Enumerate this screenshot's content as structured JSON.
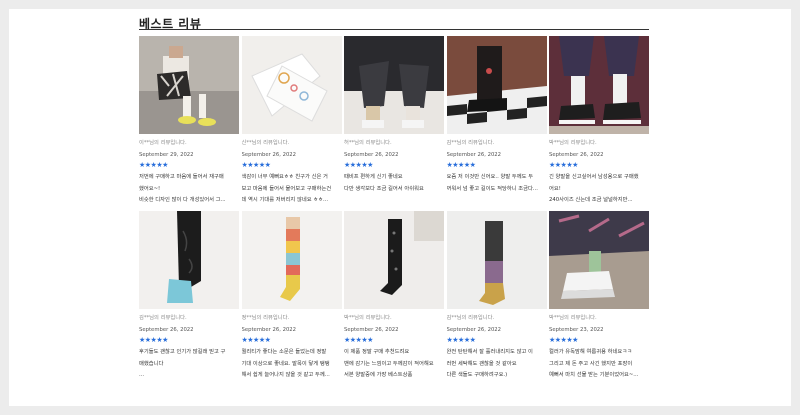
{
  "section": {
    "title": "베스트 리뷰"
  },
  "colors": {
    "star": "#2a6fdb",
    "rule": "#333333"
  },
  "reviews": [
    {
      "reviewer": "이**님의 리뷰입니다.",
      "date": "September 29, 2022",
      "stars": "★★★★★",
      "lines": [
        "저번에 구매하고 마음에 들어서 재구매",
        "했어요~!",
        "비슷한 디자인 많이 다 개성있어서 그..."
      ]
    },
    {
      "reviewer": "신**님의 리뷰입니다.",
      "date": "September 26, 2022",
      "stars": "★★★★★",
      "lines": [
        "색감이 너무 예뻐요ㅎㅎ 친구가 신은 거",
        "보고 마음에 들어서 물어보고 구매하는건",
        "데 역시 기대를 저버리지 않네요 ㅎㅎ..."
      ]
    },
    {
      "reviewer": "허**님의 리뷰입니다.",
      "date": "September 26, 2022",
      "stars": "★★★★★",
      "lines": [
        "때비프 편하게 신기 좋네요",
        "다만 생각보다 조금 길어서 아쉬워요"
      ]
    },
    {
      "reviewer": "김**님의 리뷰입니다.",
      "date": "September 26, 2022",
      "stars": "★★★★★",
      "lines": [
        "요즘 저 이것만 신어요.. 양말 두께도 두",
        "꺼워서 넘 좋고 길이도 적당하니 조금다..."
      ]
    },
    {
      "reviewer": "박**님의 리뷰입니다.",
      "date": "September 26, 2022",
      "stars": "★★★★★",
      "lines": [
        "긴 양말을 신고싶어서 남성용으로 구매했",
        "어요!",
        "240사이즈 신는데 조금 널널하지만..."
      ]
    },
    {
      "reviewer": "김**님의 리뷰입니다.",
      "date": "September 26, 2022",
      "stars": "★★★★★",
      "lines": [
        "후기들도 괜찮고 인기가 많길래 믿고 구",
        "매했습니다",
        "..."
      ]
    },
    {
      "reviewer": "정**님의 리뷰입니다.",
      "date": "September 26, 2022",
      "stars": "★★★★★",
      "lines": [
        "퀄리티가 좋다는 소문은 들었는데 정말",
        "기대 이상으로 좋네요. 발목이 닿게 탱탱",
        "해서 쉽게 늘어나지 않을 것 같고 두께..."
      ]
    },
    {
      "reviewer": "박**님의 리뷰입니다.",
      "date": "September 26, 2022",
      "stars": "★★★★★",
      "lines": [
        "이 제품 정말 구매 추천드려요",
        "밴에 감기는 느낌이고 두께감이 적어해요",
        "서본 양말중에 가장 베스트상품"
      ]
    },
    {
      "reviewer": "김**님의 리뷰입니다.",
      "date": "September 26, 2022",
      "stars": "★★★★★",
      "lines": [
        "완전 탄탄해서 잘 흘러내리지도 않고 이",
        "러번 세탁해도 괜찮을 것 같아요",
        "다른 색들도 구매하려구요.)"
      ]
    },
    {
      "reviewer": "박**님의 리뷰입니다.",
      "date": "September 23, 2022",
      "stars": "★★★★★",
      "lines": [
        "컬러가 유독맘해 여름귀용 하네요ㅋㅋ",
        "그리고 제 돈 주고 사긴 했지만 포장이",
        "예뻐서 마치 선물 받는 기분이었어요~..."
      ]
    }
  ]
}
